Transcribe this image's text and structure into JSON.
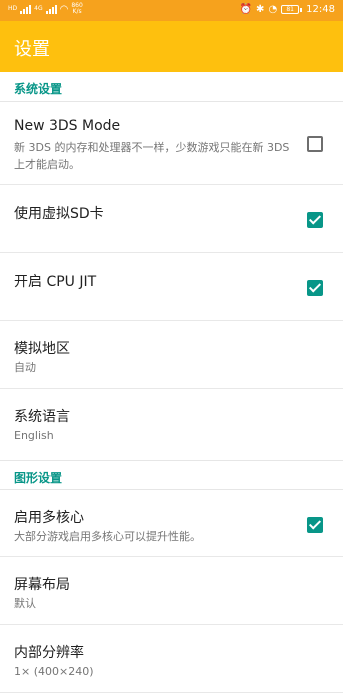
{
  "status_bar": {
    "left_tag_1": "HD",
    "left_tag_2": "4G",
    "net_speed_value": "860",
    "net_speed_unit": "K/s",
    "battery_level": "81",
    "time": "12:48"
  },
  "app_bar": {
    "title": "设置"
  },
  "sections": {
    "system": {
      "header": "系统设置"
    },
    "graphics": {
      "header": "图形设置"
    }
  },
  "prefs": {
    "new3ds": {
      "title": "New 3DS Mode",
      "summary": "新 3DS 的内存和处理器不一样，少数游戏只能在新 3DS 上才能启动。",
      "checked": false
    },
    "virtual_sd": {
      "title": "使用虚拟SD卡",
      "checked": true
    },
    "cpu_jit": {
      "title": "开启 CPU JIT",
      "checked": true
    },
    "region": {
      "title": "模拟地区",
      "summary": "自动"
    },
    "language": {
      "title": "系统语言",
      "summary": "English"
    },
    "multicore": {
      "title": "启用多核心",
      "summary": "大部分游戏启用多核心可以提升性能。",
      "checked": true
    },
    "layout": {
      "title": "屏幕布局",
      "summary": "默认"
    },
    "resolution": {
      "title": "内部分辨率",
      "summary": "1× (400×240)"
    }
  },
  "colors": {
    "status_bar": "#f6a21d",
    "app_bar": "#fec00e",
    "accent": "#089688"
  }
}
